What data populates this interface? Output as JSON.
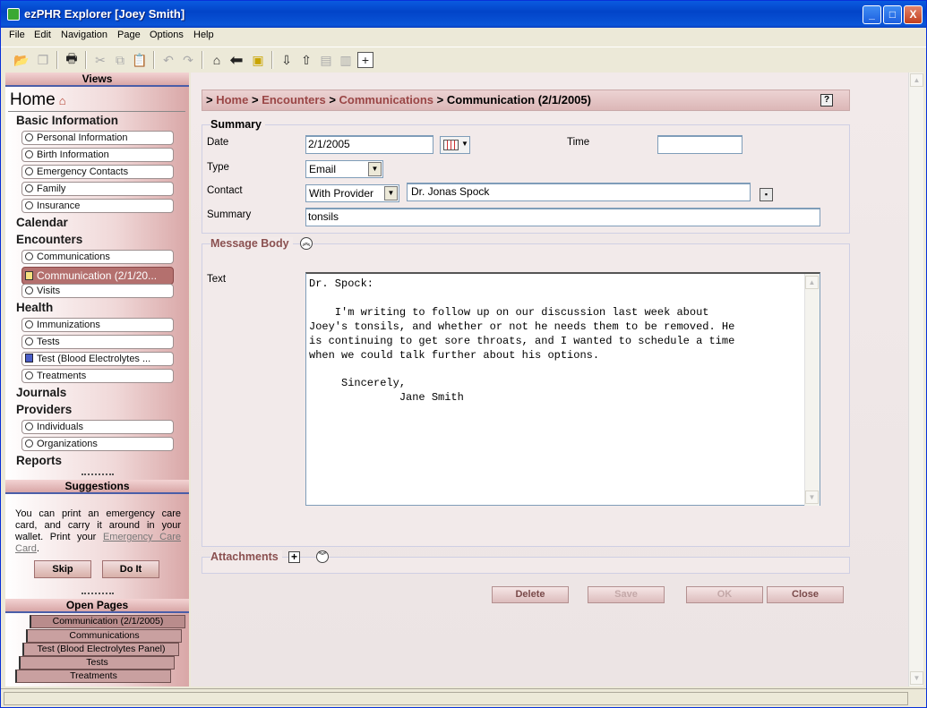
{
  "window": {
    "title": "ezPHR Explorer [Joey Smith]",
    "min": "_",
    "max": "□",
    "close": "X"
  },
  "menu": [
    "File",
    "Edit",
    "Navigation",
    "Page",
    "Options",
    "Help"
  ],
  "sidebar": {
    "views_header": "Views",
    "home": "Home",
    "home_icon": "⌂",
    "categories": {
      "basic": "Basic Information",
      "calendar": "Calendar",
      "encounters": "Encounters",
      "health": "Health",
      "journals": "Journals",
      "providers": "Providers",
      "reports": "Reports"
    },
    "items": {
      "personal": "Personal Information",
      "birth": "Birth Information",
      "emergency": "Emergency Contacts",
      "family": "Family",
      "insurance": "Insurance",
      "communications": "Communications",
      "communication_sel": "Communication (2/1/20...",
      "visits": "Visits",
      "immunizations": "Immunizations",
      "tests": "Tests",
      "test_blood": "Test (Blood Electrolytes ...",
      "treatments": "Treatments",
      "individuals": "Individuals",
      "organizations": "Organizations"
    },
    "suggestions_header": "Suggestions",
    "suggestion_text": "You can print an emergency care card, and carry it around in your wallet. Print your ",
    "suggestion_link": "Emergency Care Card",
    "suggestion_end": ".",
    "skip": "Skip",
    "doit": "Do It",
    "open_pages_header": "Open Pages",
    "open_pages": [
      "Communication (2/1/2005)",
      "Communications",
      "Test (Blood Electrolytes Panel)",
      "Tests",
      "Treatments"
    ]
  },
  "breadcrumb": {
    "prefix": ">",
    "home": "Home",
    "sep": ">",
    "encounters": "Encounters",
    "communications": "Communications",
    "current": "Communication (2/1/2005)",
    "help": "?"
  },
  "summary": {
    "title": "Summary",
    "date_label": "Date",
    "date_value": "2/1/2005",
    "time_label": "Time",
    "time_value": "",
    "type_label": "Type",
    "type_value": "Email",
    "contact_label": "Contact",
    "contact_type": "With Provider",
    "contact_name": "Dr. Jonas Spock",
    "summary_label": "Summary",
    "summary_value": "tonsils"
  },
  "message": {
    "title": "Message Body",
    "text_label": "Text",
    "body": "Dr. Spock:\n\n    I'm writing to follow up on our discussion last week about\nJoey's tonsils, and whether or not he needs them to be removed. He\nis continuing to get sore throats, and I wanted to schedule a time\nwhen we could talk further about his options.\n\n     Sincerely,\n              Jane Smith"
  },
  "attachments": {
    "title": "Attachments"
  },
  "actions": {
    "delete": "Delete",
    "save": "Save",
    "ok": "OK",
    "close": "Close"
  }
}
